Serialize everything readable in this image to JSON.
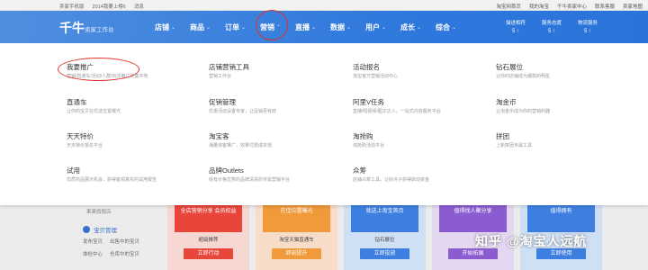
{
  "topbar": {
    "left": [
      "卖家手机版",
      "2014我要上榜6",
      "消息"
    ],
    "right": [
      "淘宝网首页",
      "我的淘宝",
      "千牛卖家中心",
      "联系客服",
      "卖家地图"
    ]
  },
  "navbar": {
    "logo": "千牛",
    "logo_sub": "卖家工作台",
    "menu": [
      {
        "label": "店铺"
      },
      {
        "label": "商品"
      },
      {
        "label": "订单"
      },
      {
        "label": "营销"
      },
      {
        "label": "直播"
      },
      {
        "label": "数据"
      },
      {
        "label": "用户"
      },
      {
        "label": "成长"
      },
      {
        "label": "综合"
      }
    ],
    "stats": [
      {
        "label": "描述相符",
        "value": "5 ↑"
      },
      {
        "label": "服务态度",
        "value": "5 ↑"
      },
      {
        "label": "物流服务",
        "value": "5 ↑"
      }
    ]
  },
  "panel": {
    "items": [
      {
        "title": "我要推广",
        "desc": "营销/直通车/活动/人群/玩法推广的集中地"
      },
      {
        "title": "店铺营销工具",
        "desc": "营销工作台"
      },
      {
        "title": "活动报名",
        "desc": "淘宝官方营销活动中心"
      },
      {
        "title": "钻石展位",
        "desc": "让你的店铺成为爆款的明星"
      },
      {
        "title": "直通车",
        "desc": "让你的宝贝在优选位置曝光"
      },
      {
        "title": "促销管理",
        "desc": "优惠活动设置专家，让促销更有效"
      },
      {
        "title": "阿里V任务",
        "desc": "直播/短视频/图文达人，一站式内容服务平台"
      },
      {
        "title": "淘金币",
        "desc": "让淘金币成为你的营销利器"
      },
      {
        "title": "天天特价",
        "desc": "天天特价报名平台"
      },
      {
        "title": "淘宝客",
        "desc": "海量淘客推广，效果付费成本低"
      },
      {
        "title": "淘抢购",
        "desc": "淘抢购活动平台"
      },
      {
        "title": "拼团",
        "desc": "上新拼团专属工具"
      },
      {
        "title": "试用",
        "desc": "优质商品展示机会，获得客观真实的试用报告"
      },
      {
        "title": "品牌Outlets",
        "desc": "给有价格优势的品牌清货的专属营销平台"
      },
      {
        "title": "众筹",
        "desc": "店铺众筹工具，让好点子获得启动资金"
      }
    ]
  },
  "background": {
    "side_text": "果果旗舰店",
    "section": "宝贝管理",
    "links": [
      "发布宝贝",
      "出售中的宝贝",
      "体检中心",
      "仓库中的宝贝"
    ],
    "cards": [
      {
        "banner": "全店营销分享\n会员权益",
        "name": "超级推荐",
        "button": "立即行动"
      },
      {
        "banner": "在佳位置曝光",
        "name": "淘宝天猫直通车",
        "button": "即刻提升"
      },
      {
        "banner": "就送上淘宝首页",
        "name": "钻石展位",
        "button": "立即投放"
      },
      {
        "banner": "值得找人聚分享",
        "name": "",
        "button": "开始拓展"
      },
      {
        "banner": "值得拥有",
        "name": "",
        "button": "立即使用"
      }
    ]
  },
  "watermark": "知乎 @淘宝人远航"
}
